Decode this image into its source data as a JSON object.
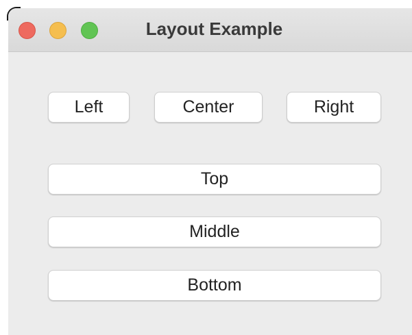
{
  "window": {
    "title": "Layout Example"
  },
  "row_buttons": {
    "left": "Left",
    "center": "Center",
    "right": "Right"
  },
  "column_buttons": {
    "top": "Top",
    "middle": "Middle",
    "bottom": "Bottom"
  },
  "colors": {
    "close": "#ee6a5f",
    "minimize": "#f5be4f",
    "zoom": "#61c454",
    "window_background": "#ececec",
    "button_background": "#ffffff"
  }
}
